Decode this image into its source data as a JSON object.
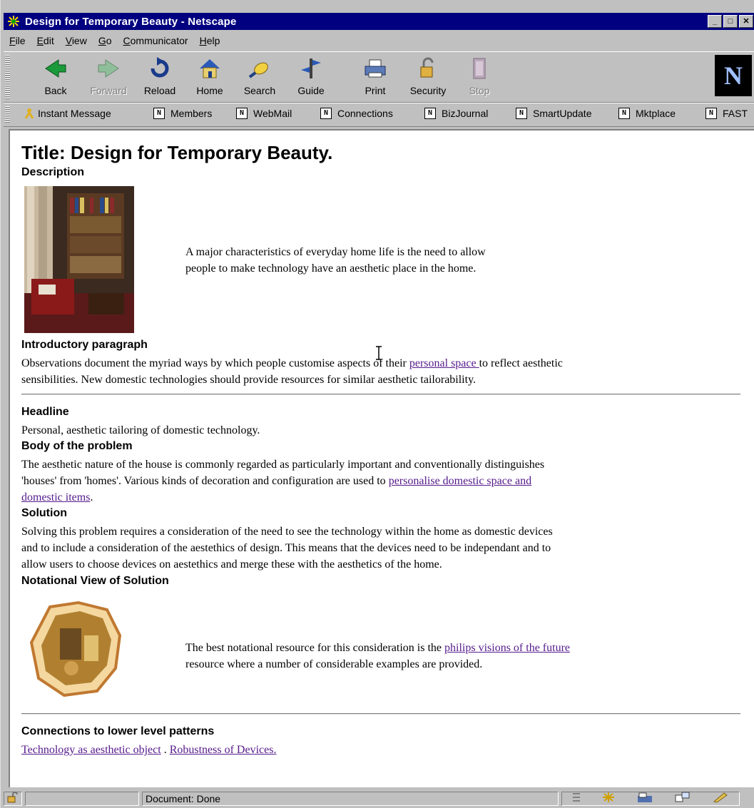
{
  "window": {
    "title": "Design for Temporary Beauty - Netscape",
    "minimize_glyph": "_",
    "maximize_glyph": "□",
    "close_glyph": "✕"
  },
  "menu": {
    "items": [
      "File",
      "Edit",
      "View",
      "Go",
      "Communicator",
      "Help"
    ],
    "mnemonics": [
      "F",
      "E",
      "V",
      "G",
      "C",
      "H"
    ]
  },
  "toolbar": {
    "buttons": [
      {
        "label": "Back",
        "icon": "back-arrow-icon",
        "enabled": true
      },
      {
        "label": "Forward",
        "icon": "forward-arrow-icon",
        "enabled": false
      },
      {
        "label": "Reload",
        "icon": "reload-icon",
        "enabled": true
      },
      {
        "label": "Home",
        "icon": "home-icon",
        "enabled": true
      },
      {
        "label": "Search",
        "icon": "search-icon",
        "enabled": true
      },
      {
        "label": "Guide",
        "icon": "guide-icon",
        "enabled": true
      },
      {
        "label": "Print",
        "icon": "print-icon",
        "enabled": true
      },
      {
        "label": "Security",
        "icon": "security-lock-icon",
        "enabled": true
      },
      {
        "label": "Stop",
        "icon": "stop-icon",
        "enabled": false
      }
    ],
    "logo_letter": "N"
  },
  "personal_toolbar": {
    "items": [
      "Instant Message",
      "Members",
      "WebMail",
      "Connections",
      "BizJournal",
      "SmartUpdate",
      "Mktplace",
      "FAST"
    ],
    "bookmark_glyph": "N"
  },
  "page": {
    "title": "Title: Design for Temporary Beauty.",
    "description_label": "Description",
    "description_text_1": "A major characteristics of everyday home life is the need to allow",
    "description_text_2": "people to make technology have an aesthetic place in the home.",
    "intro_label": "Introductory paragraph",
    "intro_text_before": "Observations document the myriad ways by which people customise aspects of their ",
    "intro_link": "personal space ",
    "intro_text_after": "to reflect aesthetic",
    "intro_text_line2": "sensibilities. New domestic technologies should provide resources for similar aesthetic tailorability.",
    "headline_label": "Headline",
    "headline_text": "Personal, aesthetic tailoring of domestic technology.",
    "body_label": "Body of the problem",
    "body_text_line1": "The aesthetic nature of the house is commonly regarded as particularly important and conventionally distinguishes",
    "body_text_line2_before": "'houses' from 'homes'. Various kinds of decoration and configuration are used to ",
    "body_link_line2": "personalise domestic space and",
    "body_link_line3": "domestic items",
    "body_text_line3_after": ".",
    "solution_label": "Solution",
    "solution_line1": "Solving this problem requires a consideration of the need to see the technology within the home as domestic devices",
    "solution_line2": "and to include a consideration of the aestethics of design. This means that the devices need to be independant and to",
    "solution_line3": "allow users to choose devices on aestethics and merge these with the aesthetics of the home.",
    "notational_label": "Notational View of Solution",
    "notational_before": "The best notational resource for this consideration is the ",
    "notational_link": "philips visions of the future",
    "notational_line2": "resource where a number of considerable examples are provided.",
    "connections_label": "Connections to lower level patterns",
    "connections_link1": "Technology as aesthetic object",
    "connections_sep": " . ",
    "connections_link2": "Robustness of Devices."
  },
  "status": {
    "text": "Document: Done"
  },
  "colors": {
    "title_bar": "#000080",
    "link": "#551a8b",
    "chrome": "#c0c0c0"
  }
}
